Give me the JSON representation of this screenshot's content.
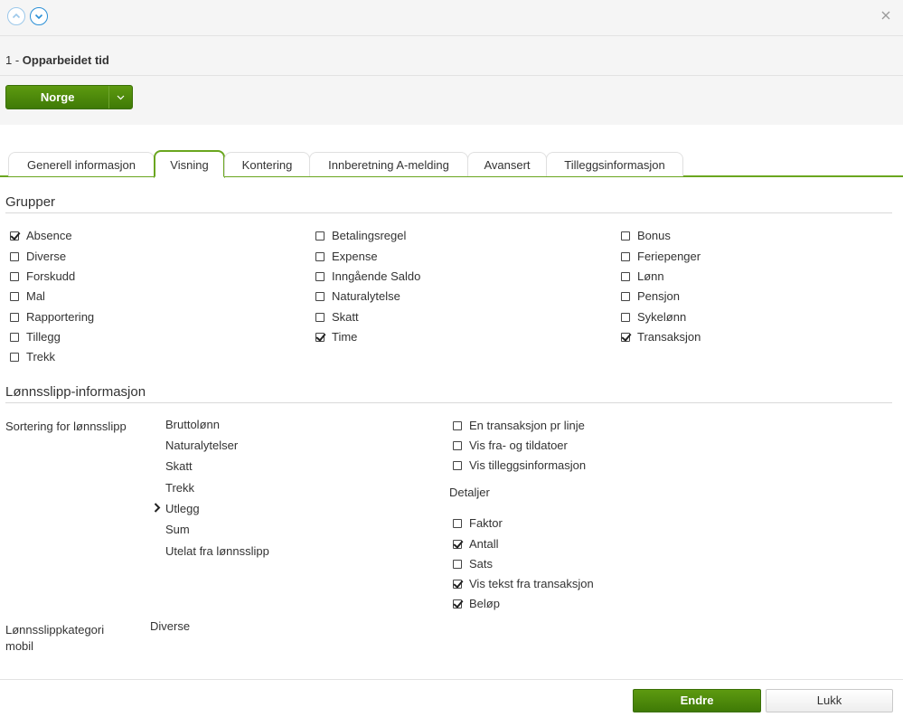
{
  "header": {
    "title_number": "1 - ",
    "title_name": "Opparbeidet tid"
  },
  "country_button": {
    "label": "Norge"
  },
  "tabs": [
    {
      "label": "Generell informasjon",
      "active": false
    },
    {
      "label": "Visning",
      "active": true
    },
    {
      "label": "Kontering",
      "active": false
    },
    {
      "label": "Innberetning A-melding",
      "active": false
    },
    {
      "label": "Avansert",
      "active": false
    },
    {
      "label": "Tilleggsinformasjon",
      "active": false
    }
  ],
  "grupper": {
    "title": "Grupper",
    "col1": [
      {
        "label": "Absence",
        "checked": true
      },
      {
        "label": "Diverse",
        "checked": false
      },
      {
        "label": "Forskudd",
        "checked": false
      },
      {
        "label": "Mal",
        "checked": false
      },
      {
        "label": "Rapportering",
        "checked": false
      },
      {
        "label": "Tillegg",
        "checked": false
      },
      {
        "label": "Trekk",
        "checked": false
      }
    ],
    "col2": [
      {
        "label": "Betalingsregel",
        "checked": false
      },
      {
        "label": "Expense",
        "checked": false
      },
      {
        "label": "Inngående Saldo",
        "checked": false
      },
      {
        "label": "Naturalytelse",
        "checked": false
      },
      {
        "label": "Skatt",
        "checked": false
      },
      {
        "label": "Time",
        "checked": true
      }
    ],
    "col3": [
      {
        "label": "Bonus",
        "checked": false
      },
      {
        "label": "Feriepenger",
        "checked": false
      },
      {
        "label": "Lønn",
        "checked": false
      },
      {
        "label": "Pensjon",
        "checked": false
      },
      {
        "label": "Sykelønn",
        "checked": false
      },
      {
        "label": "Transaksjon",
        "checked": true
      }
    ]
  },
  "lonnsslipp": {
    "title": "Lønnsslipp-informasjon",
    "sort_label": "Sortering for lønnsslipp",
    "sort_items": [
      "Bruttolønn",
      "Naturalytelser",
      "Skatt",
      "Trekk",
      "Utlegg",
      "Sum",
      "Utelat fra lønnsslipp"
    ],
    "options": [
      {
        "label": "En transaksjon pr linje",
        "checked": false
      },
      {
        "label": "Vis fra- og tildatoer",
        "checked": false
      },
      {
        "label": "Vis tilleggsinformasjon",
        "checked": false
      }
    ],
    "detaljer_label": "Detaljer",
    "detaljer": [
      {
        "label": "Faktor",
        "checked": false
      },
      {
        "label": "Antall",
        "checked": true
      },
      {
        "label": "Sats",
        "checked": false
      },
      {
        "label": "Vis tekst fra transaksjon",
        "checked": true
      },
      {
        "label": "Beløp",
        "checked": true
      }
    ],
    "kategori_label_line1": "Lønnsslippkategori",
    "kategori_label_line2": "mobil",
    "kategori_value": "Diverse"
  },
  "footer": {
    "endre_label": "Endre",
    "lukk_label": "Lukk"
  },
  "colors": {
    "primary_green": "#4a8a0b",
    "tab_accent": "#6aa61f",
    "nav_blue": "#2a8fd6"
  }
}
